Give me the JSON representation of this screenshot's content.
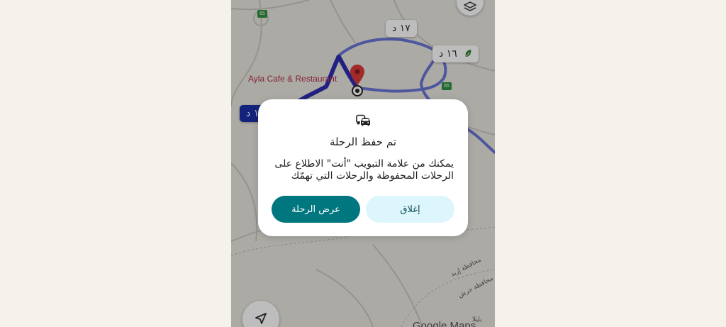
{
  "map": {
    "eta_chips": {
      "top": "١٧ د",
      "right": "١٦ د",
      "left": "١ د"
    },
    "place_label": "Ayla Cafe & Restaurant",
    "highway_shield": "65",
    "governorate_labels": [
      "محافظة إربد",
      "محافظة جرش"
    ],
    "town_label": "بليلا",
    "watermark": "Google Maps",
    "colors": {
      "route_primary": "#2c2aa8",
      "route_alt": "#6673d8",
      "pin": "#d93a3a"
    },
    "icons": {
      "layers": "layers-icon",
      "navigate": "navigation-arrow-icon",
      "eco": "leaf-icon"
    }
  },
  "dialog": {
    "icon": "cars-icon",
    "title": "تم حفظ الرحلة",
    "body": "يمكنك من علامة التبويب \"أنت\" الاطلاع على الرحلات المحفوظة والرحلات التي تهمّك",
    "close_label": "إغلاق",
    "view_label": "عرض الرحلة",
    "colors": {
      "close_bg": "#dcf6fc",
      "view_bg": "#00767f"
    }
  }
}
